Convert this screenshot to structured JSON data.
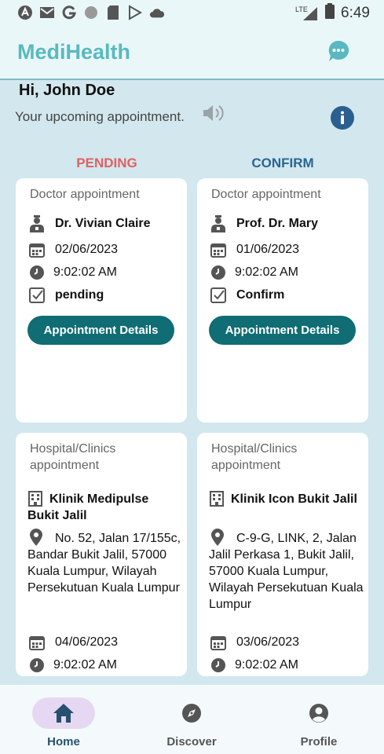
{
  "status_bar": {
    "time": "6:49",
    "network_label": "LTE",
    "left_icons": [
      "android-icon",
      "gmail-icon",
      "google-icon",
      "circle-icon",
      "sd-card-icon",
      "play-store-icon",
      "cloud-icon"
    ],
    "right_icons": [
      "signal-icon",
      "battery-icon"
    ]
  },
  "app_bar": {
    "title": "MediHealth",
    "chat_icon": "chat-bubble-icon",
    "title_color": "#59b9c0"
  },
  "header": {
    "greeting": "Hi, John Doe",
    "subtitle": "Your upcoming appointment."
  },
  "columns": {
    "pending_label": "PENDING",
    "confirm_label": "CONFIRM"
  },
  "doctor_appointments": [
    {
      "type": "Doctor appointment",
      "doctor": "Dr. Vivian Claire",
      "date": "02/06/2023",
      "time": "9:02:02 AM",
      "status": "pending",
      "button": "Appointment Details"
    },
    {
      "type": "Doctor appointment",
      "doctor": "Prof. Dr. Mary",
      "date": "01/06/2023",
      "time": "9:02:02 AM",
      "status": "Confirm",
      "button": "Appointment Details"
    }
  ],
  "hospital_appointments": [
    {
      "type": "Hospital/Clinics appointment",
      "name": "Klinik Medipulse Bukit Jalil",
      "address": "No. 52, Jalan 17/155c, Bandar Bukit Jalil, 57000 Kuala Lumpur, Wilayah Persekutuan Kuala Lumpur",
      "date": "04/06/2023",
      "time": "9:02:02 AM"
    },
    {
      "type": "Hospital/Clinics appointment",
      "name": "Klinik Icon Bukit Jalil",
      "address": "C-9-G, LINK, 2, Jalan Jalil Perkasa 1, Bukit Jalil, 57000 Kuala Lumpur, Wilayah Persekutuan Kuala Lumpur",
      "date": "03/06/2023",
      "time": "9:02:02 AM"
    }
  ],
  "bottom_nav": [
    {
      "label": "Home",
      "icon": "home-icon",
      "active": true
    },
    {
      "label": "Discover",
      "icon": "compass-icon",
      "active": false
    },
    {
      "label": "Profile",
      "icon": "account-circle-icon",
      "active": false
    }
  ],
  "colors": {
    "pending": "#e06161",
    "confirm": "#2a6591",
    "button": "#0f6d73",
    "background": "#d2e7ee"
  }
}
